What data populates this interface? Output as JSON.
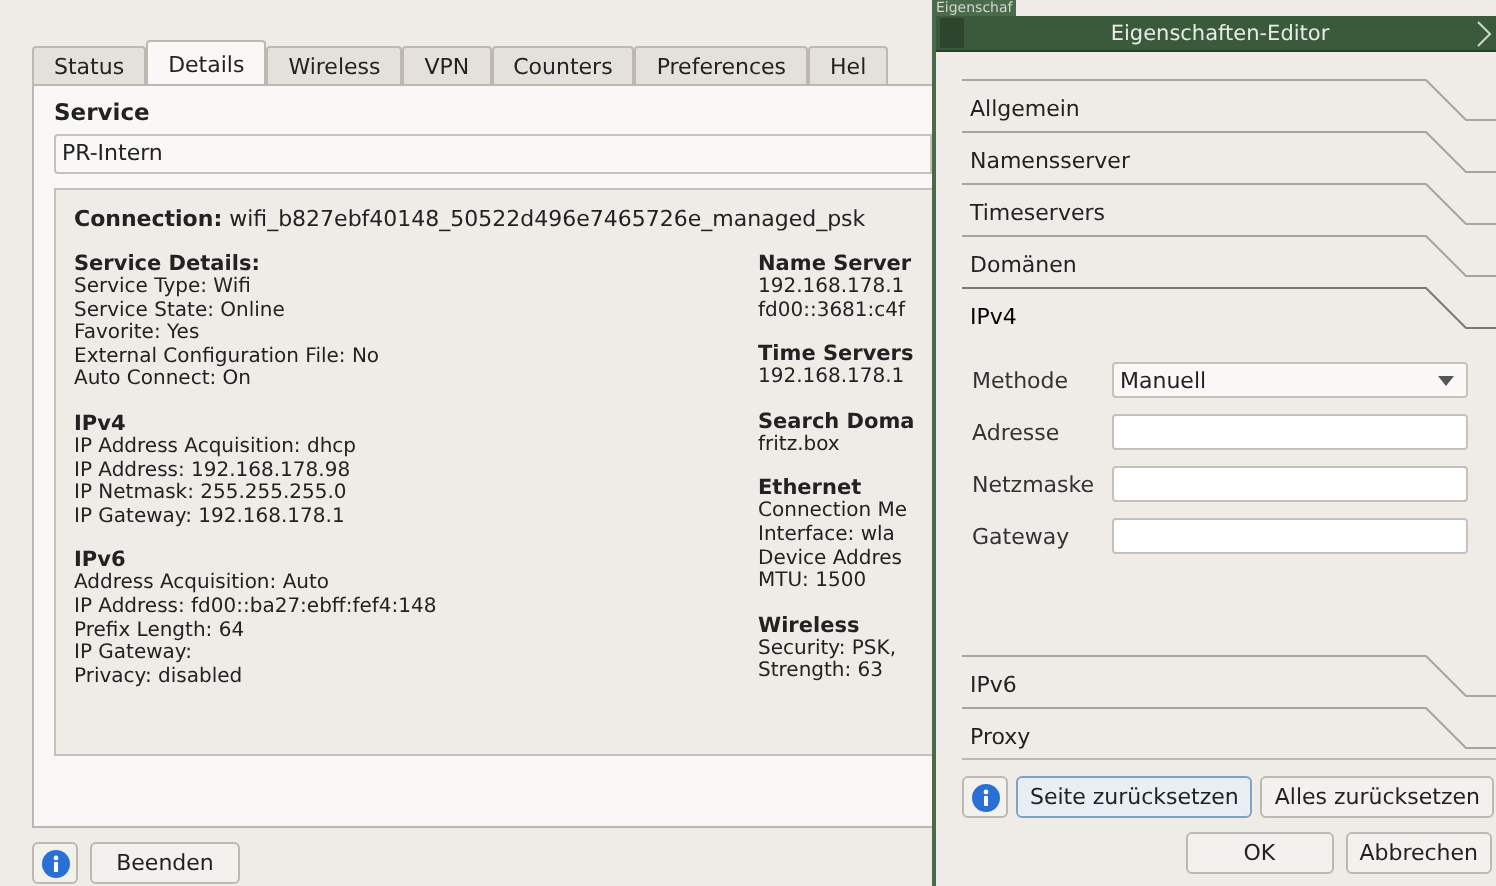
{
  "main_window": {
    "tabs": [
      {
        "label": "Status",
        "selected": false
      },
      {
        "label": "Details",
        "selected": true
      },
      {
        "label": "Wireless",
        "selected": false
      },
      {
        "label": "VPN",
        "selected": false
      },
      {
        "label": "Counters",
        "selected": false
      },
      {
        "label": "Preferences",
        "selected": false
      },
      {
        "label": "Hel",
        "selected": false
      }
    ],
    "service_label": "Service",
    "service_value": "PR-Intern",
    "connection": {
      "label": "Connection:",
      "value": "wifi_b827ebf40148_50522d496e7465726e_managed_psk"
    },
    "left_groups": [
      {
        "heading": "Service Details:",
        "lines": [
          "Service Type: Wifi",
          "Service State: Online",
          "Favorite: Yes",
          "External Configuration File: No",
          "Auto Connect: On"
        ]
      },
      {
        "heading": "IPv4",
        "lines": [
          "IP Address Acquisition: dhcp",
          "IP Address: 192.168.178.98",
          "IP Netmask: 255.255.255.0",
          "IP Gateway: 192.168.178.1"
        ]
      },
      {
        "heading": "IPv6",
        "lines": [
          "Address Acquisition: Auto",
          "IP Address: fd00::ba27:ebff:fef4:148",
          "Prefix Length: 64",
          "IP Gateway:",
          "Privacy: disabled"
        ]
      }
    ],
    "right_groups": [
      {
        "heading": "Name Server",
        "lines": [
          "192.168.178.1",
          "fd00::3681:c4f"
        ]
      },
      {
        "heading": "Time Servers",
        "lines": [
          "192.168.178.1"
        ]
      },
      {
        "heading": "Search Doma",
        "lines": [
          "fritz.box"
        ]
      },
      {
        "heading": "Ethernet",
        "lines": [
          "Connection Me",
          "Interface: wla",
          "Device Addres",
          "MTU: 1500"
        ]
      },
      {
        "heading": "Wireless",
        "lines": [
          "Security: PSK,",
          "Strength: 63"
        ]
      }
    ],
    "quit_button": "Beenden"
  },
  "dialog": {
    "tab_title": "Eigenschaf",
    "title": "Eigenschaften-Editor",
    "sections": [
      {
        "label": "Allgemein",
        "expanded": false
      },
      {
        "label": "Namensserver",
        "expanded": false
      },
      {
        "label": "Timeservers",
        "expanded": false
      },
      {
        "label": "Domänen",
        "expanded": false
      },
      {
        "label": "IPv4",
        "expanded": true,
        "fields": [
          {
            "kind": "combo",
            "label": "Methode",
            "value": "Manuell"
          },
          {
            "kind": "text",
            "label": "Adresse"
          },
          {
            "kind": "text",
            "label": "Netzmaske"
          },
          {
            "kind": "text",
            "label": "Gateway"
          }
        ]
      },
      {
        "label": "IPv6",
        "expanded": false
      },
      {
        "label": "Proxy",
        "expanded": false
      }
    ],
    "reset_page_button": "Seite zurücksetzen",
    "reset_all_button": "Alles zurücksetzen",
    "ok_button": "OK",
    "cancel_button": "Abbrechen"
  }
}
